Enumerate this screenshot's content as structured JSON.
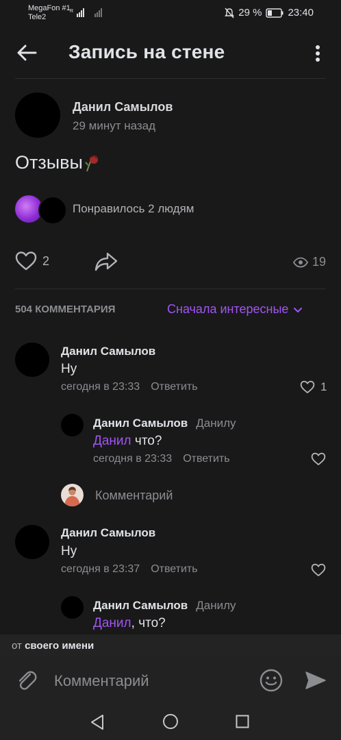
{
  "status_bar": {
    "carrier1": "MegaFon #1",
    "carrier2": "Tele2",
    "battery": "29 %",
    "time": "23:40"
  },
  "header": {
    "title": "Запись на стене"
  },
  "post": {
    "author": "Данил Самылов",
    "time": "29 минут назад",
    "text": "Отзывы",
    "liked_by": "Понравилось 2 людям",
    "likes": "2",
    "views": "19"
  },
  "comments_section": {
    "count_label": "504 КОММЕНТАРИЯ",
    "sort_label": "Сначала интересные"
  },
  "comments": [
    {
      "author": "Данил Самылов",
      "text": "Ну",
      "time": "сегодня в 23:33",
      "reply": "Ответить",
      "likes": "1"
    },
    {
      "author": "Данил Самылов",
      "to": "Данилу",
      "mention": "Данил",
      "text": " что?",
      "time": "сегодня в 23:33",
      "reply": "Ответить"
    },
    {
      "author": "Данил Самылов",
      "text": "Ну",
      "time": "сегодня в 23:37",
      "reply": "Ответить"
    },
    {
      "author": "Данил Самылов",
      "to": "Данилу",
      "mention": "Данил",
      "text": ", что?"
    }
  ],
  "reply_box": {
    "placeholder": "Комментарий"
  },
  "composer": {
    "as_prefix": "от",
    "as_name": "своего имени",
    "placeholder": "Комментарий"
  }
}
